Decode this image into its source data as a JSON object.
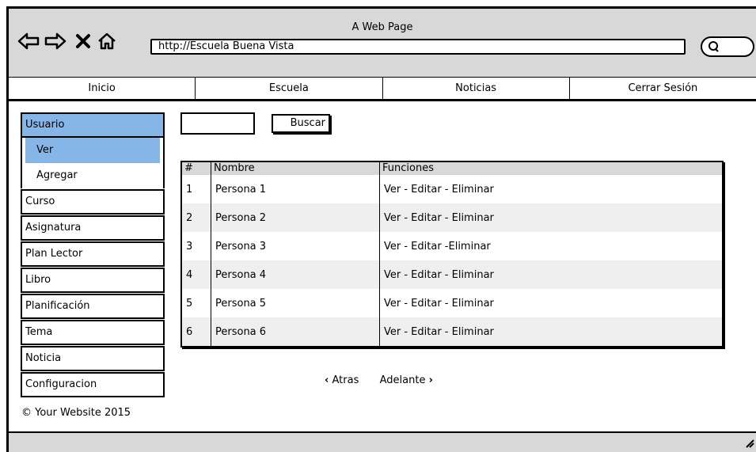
{
  "window": {
    "title": "A Web Page"
  },
  "browser": {
    "url": "http://Escuela Buena Vista"
  },
  "topnav": {
    "items": [
      "Inicio",
      "Escuela",
      "Noticias",
      "Cerrar Sesión"
    ]
  },
  "sidebar": {
    "usuario": "Usuario",
    "sub": [
      "Ver",
      "Agregar"
    ],
    "items": [
      "Curso",
      "Asignatura",
      "Plan Lector",
      "Libro",
      "Planificación",
      "Tema",
      "Noticia",
      "Configuracion"
    ]
  },
  "search": {
    "button": "Buscar"
  },
  "table": {
    "headers": [
      "#",
      "Nombre",
      "Funciones"
    ],
    "rows": [
      [
        "1",
        "Persona 1",
        "Ver - Editar - Eliminar"
      ],
      [
        "2",
        "Persona 2",
        "Ver - Editar - Eliminar"
      ],
      [
        "3",
        "Persona 3",
        "Ver - Editar -Eliminar"
      ],
      [
        "4",
        "Persona 4",
        "Ver - Editar - Eliminar"
      ],
      [
        "5",
        "Persona 5",
        "Ver - Editar - Eliminar"
      ],
      [
        "6",
        "Persona 6",
        "Ver - Editar - Eliminar"
      ]
    ]
  },
  "pager": {
    "prev": "Atras",
    "next": "Adelante"
  },
  "footer": {
    "text": "© Your Website 2015"
  }
}
